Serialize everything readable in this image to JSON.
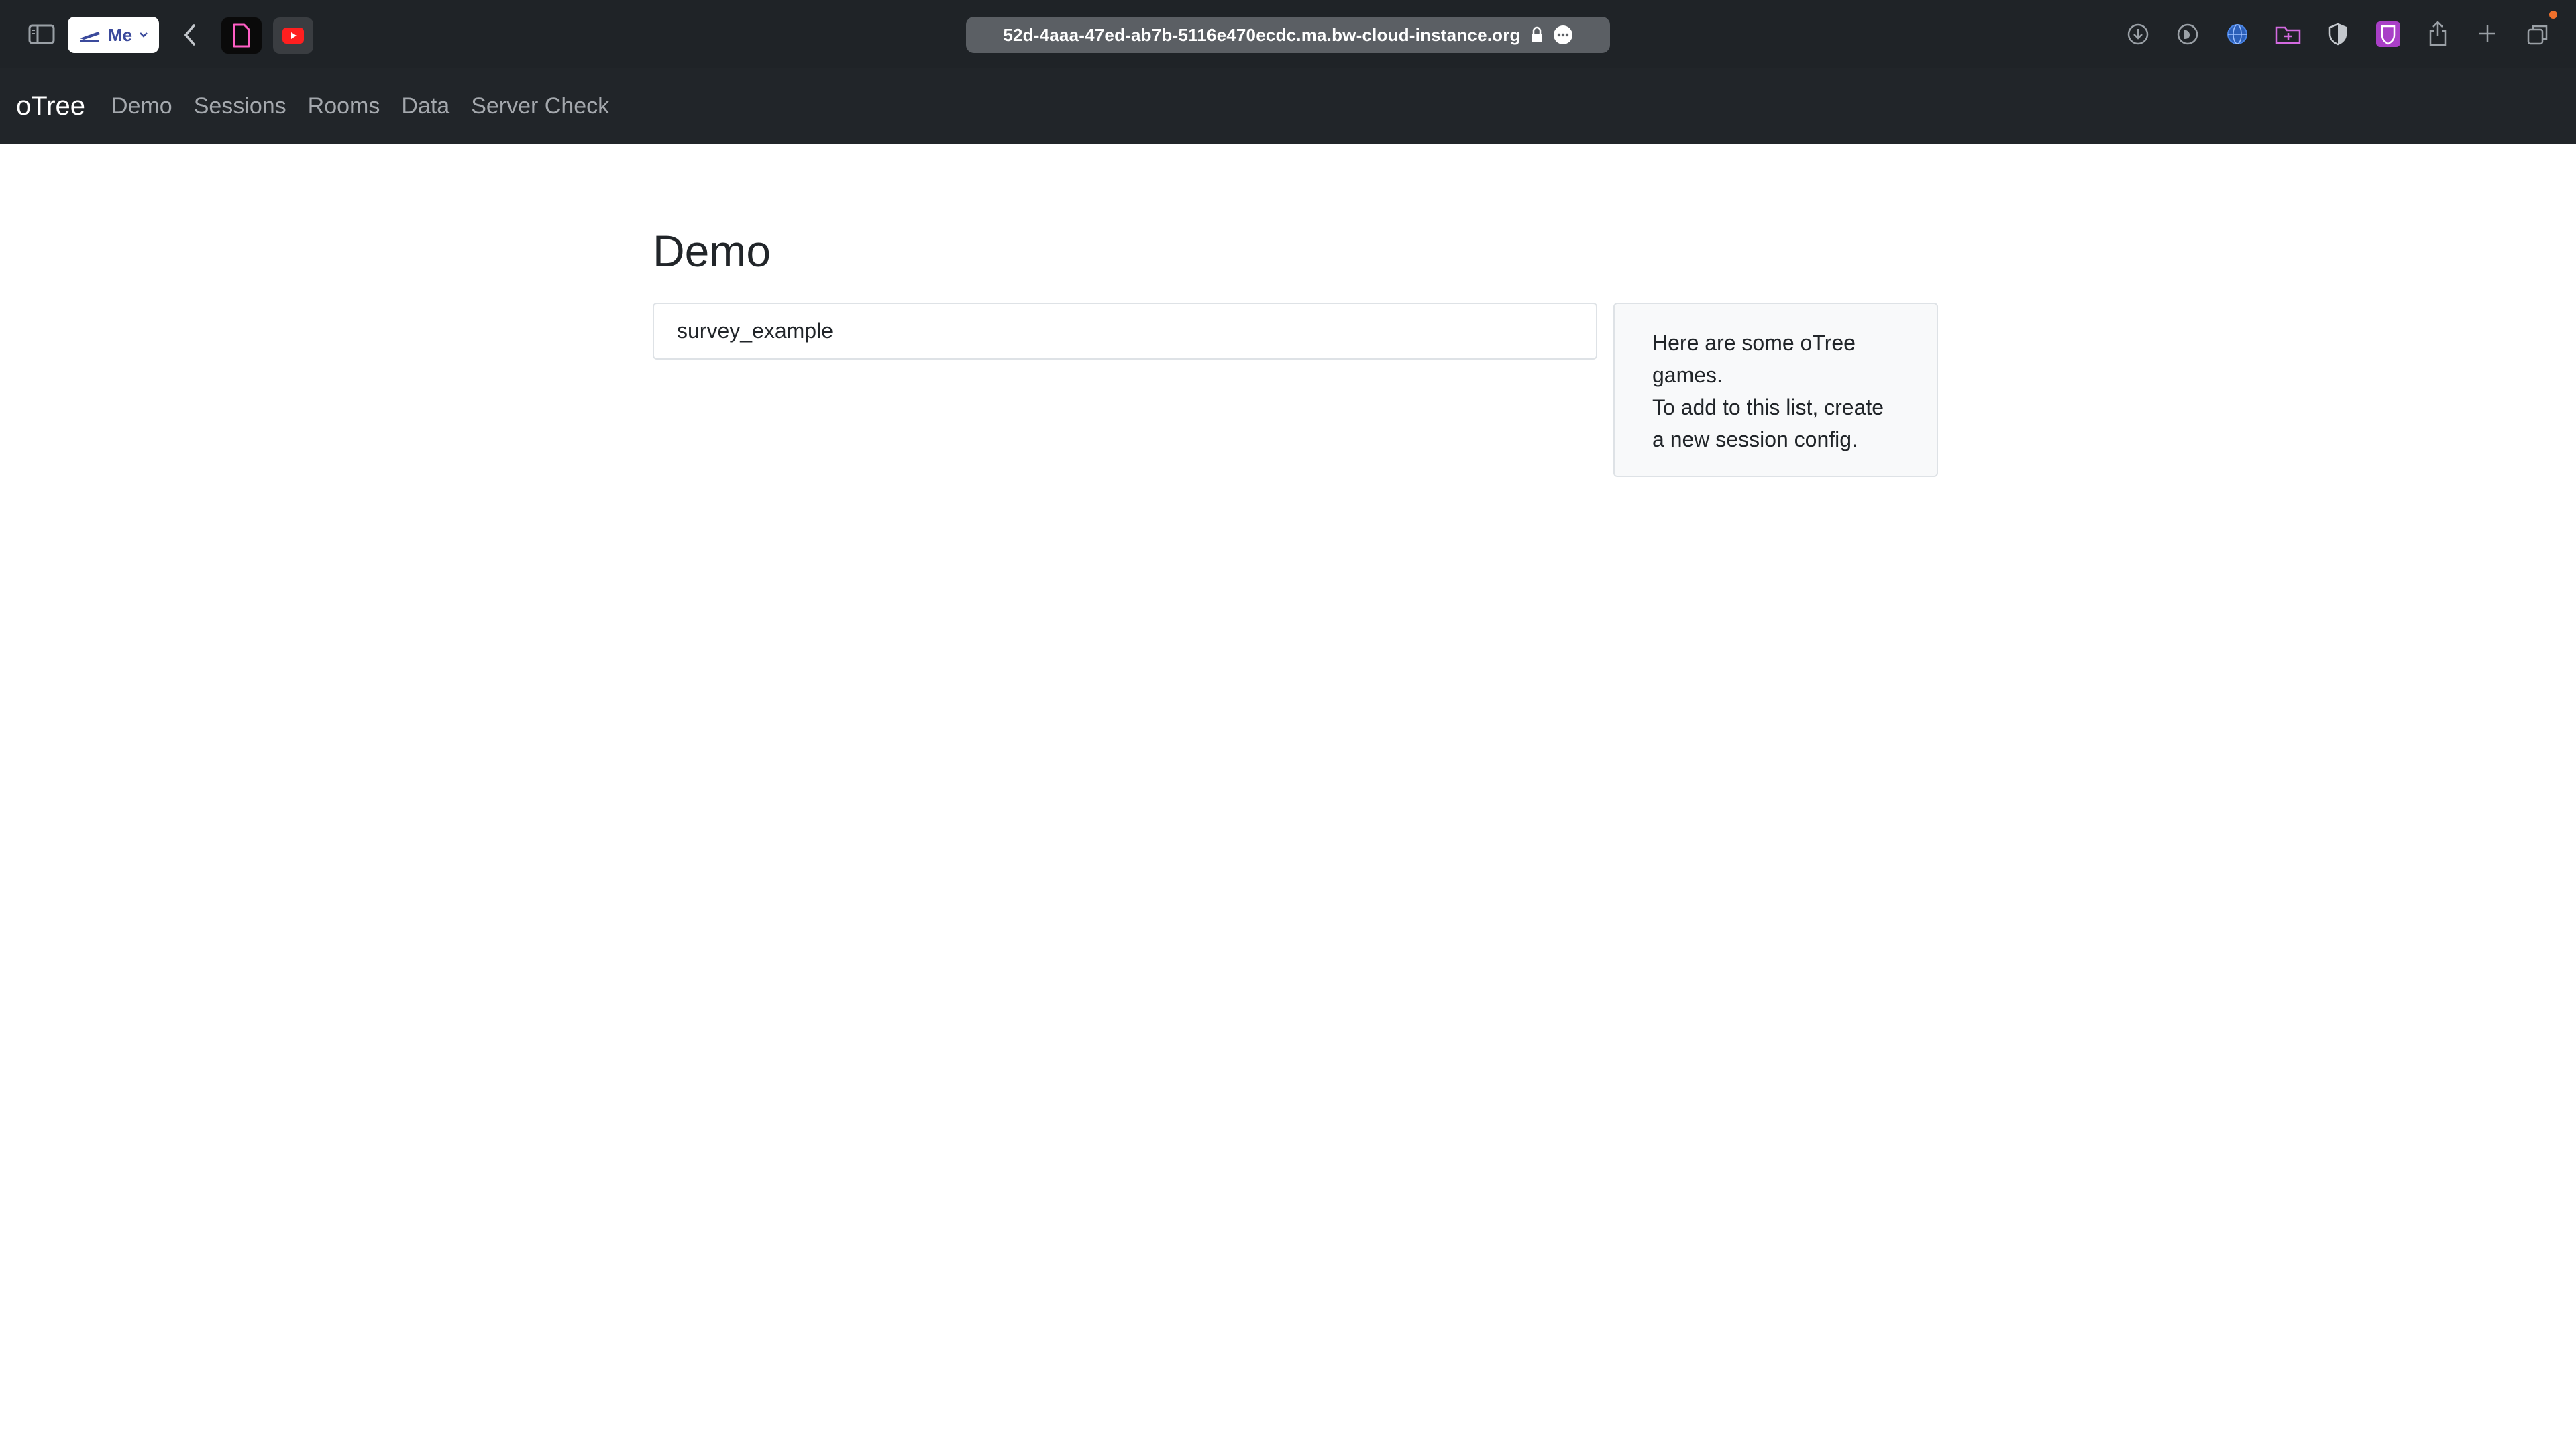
{
  "browser": {
    "profile_label": "Me",
    "address": "52d-4aaa-47ed-ab7b-5116e470ecdc.ma.bw-cloud-instance.org",
    "icons": [
      "sidebar-icon",
      "back-icon",
      "download-icon",
      "extension-icon",
      "globe-icon",
      "folder-icon",
      "shield-icon",
      "bitwarden-icon",
      "share-icon",
      "new-tab-icon",
      "tabs-overview-icon"
    ]
  },
  "navbar": {
    "brand": "oTree",
    "links": [
      "Demo",
      "Sessions",
      "Rooms",
      "Data",
      "Server Check"
    ]
  },
  "main": {
    "title": "Demo",
    "items": [
      "survey_example"
    ],
    "info_line1": "Here are some oTree games.",
    "info_line2": "To add to this list, create a new session config."
  },
  "colors": {
    "navbar_bg": "#212529",
    "browser_bg": "#1f2327",
    "nav_link": "#a4a8ad",
    "info_bg": "#f8f9fa"
  }
}
